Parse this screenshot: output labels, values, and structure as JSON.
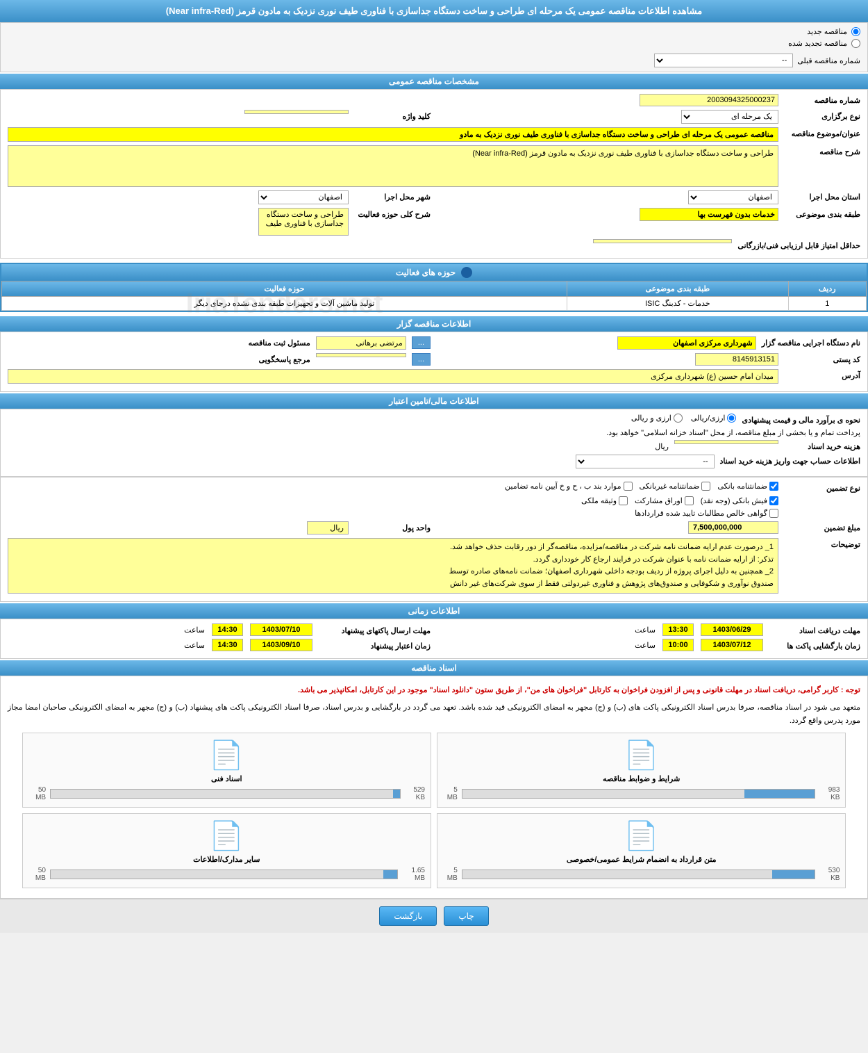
{
  "page": {
    "title": "مشاهده اطلاعات مناقصه عمومی یک مرحله ای طراحی و ساخت دستگاه جداسازی با فناوری طیف نوری نزدیک به مادون قرمز (Near infra-Red)"
  },
  "top_options": {
    "new_tender": "مناقصه جدید",
    "renewed_tender": "مناقصه تجدید شده",
    "prev_number_label": "شماره مناقصه قبلی",
    "prev_number_value": "--"
  },
  "general_specs": {
    "header": "مشخصات مناقصه عمومی",
    "tender_number_label": "شماره مناقصه",
    "tender_number_value": "2003094325000237",
    "tender_type_label": "نوع برگزاری",
    "tender_type_value": "یک مرحله ای",
    "keyword_label": "کلید واژه",
    "keyword_value": "",
    "subject_label": "عنوان/موضوع مناقصه",
    "subject_value": "مناقصه عمومی یک مرحله ای طراحی و ساخت دستگاه جداسازی با فناوری طیف نوری نزدیک به مادو",
    "desc_label": "شرح مناقصه",
    "desc_value": "طراحی و ساخت دستگاه جداسازی با فناوری طیف نوری نزدیک به مادون قرمز (Near infra-Red)",
    "province_label": "استان محل اجرا",
    "province_value": "اصفهان",
    "city_label": "شهر محل اجرا",
    "city_value": "اصفهان",
    "category_label": "طبقه بندی موضوعی",
    "category_value": "خدمات بدون فهرست بها",
    "activity_desc_label": "شرح کلی حوزه فعالیت",
    "activity_desc_value": "طراحی و ساخت دستگاه\nجداسازی با فناوری طیف",
    "min_score_label": "حداقل امتیاز قابل ارزیابی فنی/بازرگانی",
    "min_score_value": ""
  },
  "activity_areas": {
    "header": "حوزه های فعالیت",
    "columns": [
      "ردیف",
      "طبقه بندی موضوعی",
      "حوزه فعالیت"
    ],
    "rows": [
      {
        "row": "1",
        "category": "خدمات - کدبنگ ISIC",
        "area": "تولید ماشین آلات و تجهیزات طبقه بندی نشده درجای دیگر"
      }
    ]
  },
  "organizer_info": {
    "header": "اطلاعات مناقصه گزار",
    "org_name_label": "نام دستگاه اجرایی مناقصه گزار",
    "org_name_value": "شهرداری مرکزی اصفهان",
    "responsible_label": "مسئول ثبت مناقصه",
    "responsible_value": "مرتضی برهانی",
    "postal_label": "کد پستی",
    "postal_value": "8145913151",
    "ref_label": "مرجع پاسخگویی",
    "ref_value": "",
    "address_label": "آدرس",
    "address_value": "میدان امام حسین (ع) شهرداری مرکزی"
  },
  "financial_info": {
    "header": "اطلاعات مالی/تامین اعتبار",
    "estimation_label": "نحوه ی برآورد مالی و قیمت پیشنهادی",
    "estimation_rial": "ارزی/ریالی",
    "estimation_fx": "ارزی و ریالی",
    "payment_note": "پرداخت تمام و یا بخشی از مبلغ مناقصه، از محل \"اسناد خزانه اسلامی\" خواهد بود.",
    "doc_cost_label": "هزینه خرید اسناد",
    "doc_cost_value": "",
    "doc_cost_unit": "ریال",
    "account_label": "اطلاعات حساب جهت واریز هزینه خرید اسناد",
    "account_value": "--"
  },
  "guarantee": {
    "types_label": "نوع تضمین",
    "bank_guarantee": "ضمانتنامه بانکی",
    "electronic_guarantee": "ضمانتنامه غیربانکی",
    "cases": "موارد بند ب ، ح و خ آیین نامه تضامین",
    "cash_check": "فیش بانکی (وجه نقد)",
    "bonds": "اوراق مشارکت",
    "property": "وثیقه ملکی",
    "tax_cert": "گواهی خالص مطالبات تایید شده قراردادها",
    "amount_label": "مبلغ تضمین",
    "amount_value": "7,500,000,000",
    "unit_label": "واحد پول",
    "unit_value": "ریال",
    "desc_label": "توضیحات",
    "desc_lines": [
      "1_ درصورت عدم ارایه ضمانت نامه شرکت در مناقصه/مزایده، مناقصه‌گر از دور رقابت حذف خواهد شد.",
      "تذکر: از ارایه ضمانت نامه با عنوان شرکت در فرایند ارجاع کار خودداری گردد.",
      "2_ همچنین به دلیل اجرای پروژه از ردیف بودجه داخلی شهرداری اصفهان؛ ضمانت نامه‌های صادره توسط",
      "صندوق نوآوری و شکوفایی و صندوق‌های پژوهش و فناوری غیردولتی فقط از سوی شرکت‌های غیر دانش"
    ]
  },
  "dates": {
    "header": "اطلاعات زمانی",
    "doc_deadline_label": "مهلت دریافت اسناد",
    "doc_deadline_date": "1403/06/29",
    "doc_deadline_time": "13:30",
    "doc_deadline_unit": "ساعت",
    "packet_deadline_label": "مهلت ارسال پاکتهای پیشنهاد",
    "packet_deadline_date": "1403/07/10",
    "packet_deadline_time": "14:30",
    "packet_deadline_unit": "ساعت",
    "packet_open_label": "زمان بارگشایی پاکت ها",
    "packet_open_date": "1403/07/12",
    "packet_open_time": "10:00",
    "packet_open_unit": "ساعت",
    "validity_label": "زمان اعتبار پیشنهاد",
    "validity_date": "1403/09/10",
    "validity_time": "14:30",
    "validity_unit": "ساعت"
  },
  "documents": {
    "header": "اسناد مناقصه",
    "note": "توجه : کاربر گرامی، دریافت اسناد در مهلت قانونی و پس از افزودن فراخوان به کارتابل \"فراخوان های من\"، از طریق ستون \"دانلود اسناد\" موجود در این کارتابل، امکانپذیر می باشد.",
    "main_note": "متعهد می شود در اسناد مناقصه، صرفا بدرس اسناد الکترونیکی پاکت های (ب) و (ج) مجهر به امضای الکترونیکی قید شده باشد. تعهد می گردد در بارگشایی و بدرس اسناد، صرفا اسناد الکترونیکی پاکت های پیشنهاد (ب) و (ج) مجهر به امضای الکترونیکی صاحبان امضا مجاز مورد پدرس واقع گردد.",
    "files": [
      {
        "name": "شرایط و ضوابط مناقصه",
        "size": "983 KB",
        "max": "5 MB",
        "progress": 20
      },
      {
        "name": "اسناد فنی",
        "size": "529 KB",
        "max": "50 MB",
        "progress": 2
      },
      {
        "name": "متن قرارداد به انضمام شرایط عمومی/خصوصی",
        "size": "530 KB",
        "max": "5 MB",
        "progress": 12
      },
      {
        "name": "سایر مدارک/اطلاعات",
        "size": "1.65 MB",
        "max": "50 MB",
        "progress": 4
      }
    ]
  },
  "buttons": {
    "print": "چاپ",
    "back": "بازگشت"
  }
}
